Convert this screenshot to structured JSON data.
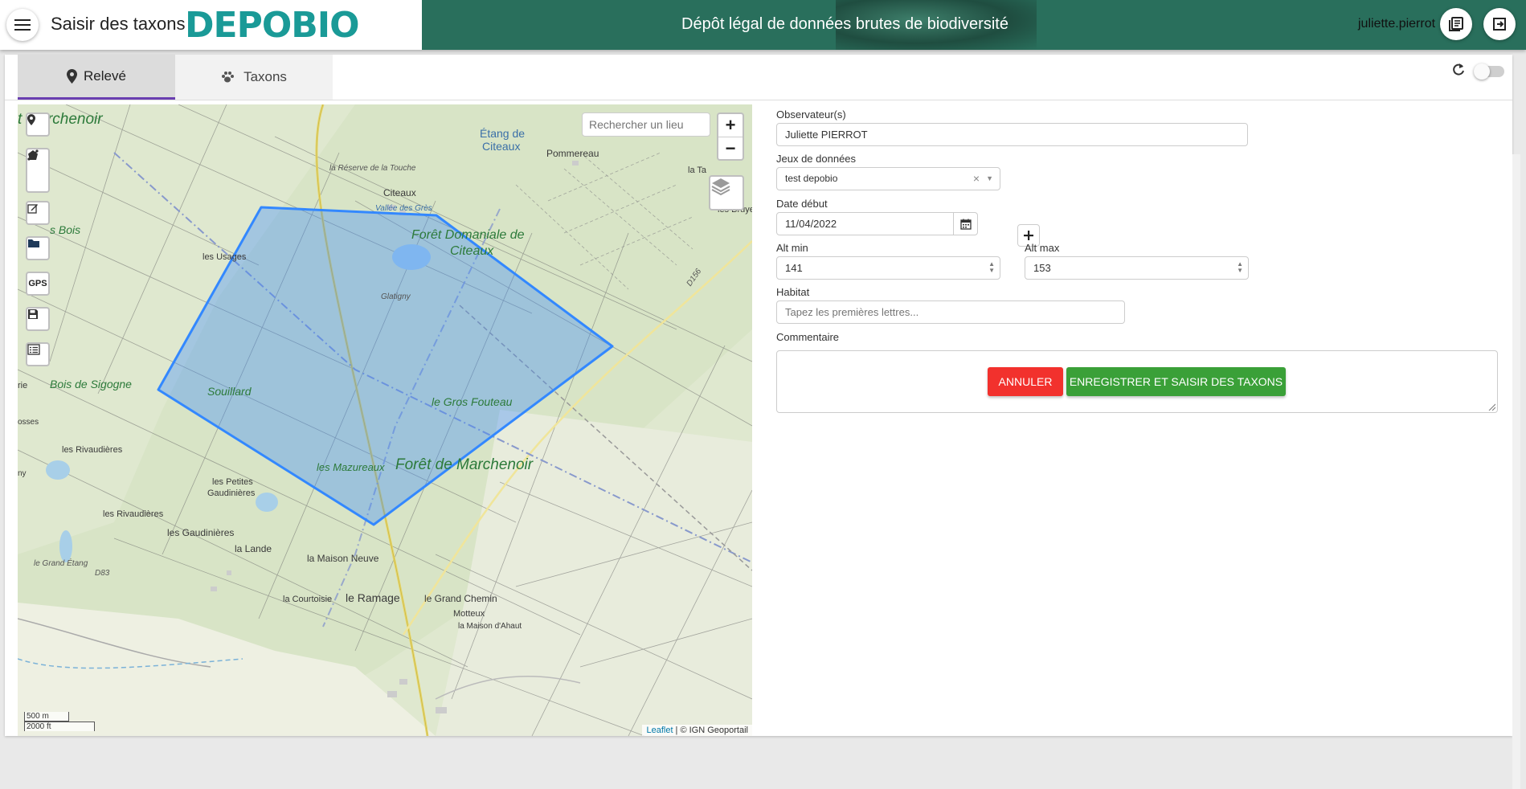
{
  "header": {
    "app_title": "Saisir des taxons",
    "logo_text": "DEPOBIO",
    "banner_text": "Dépôt légal de données brutes de biodiversité",
    "username": "juliette.pierrot",
    "icons": [
      "menu-icon",
      "book-icon",
      "logout-icon"
    ]
  },
  "tabs": [
    {
      "label": "Relevé",
      "icon": "map-marker-icon",
      "active": true
    },
    {
      "label": "Taxons",
      "icon": "paw-icon",
      "active": false
    }
  ],
  "map": {
    "search_placeholder": "Rechercher un lieu",
    "zoom_in": "+",
    "zoom_out": "−",
    "gps_label": "GPS",
    "scale_metric": "500 m",
    "scale_imperial": "2000 ft",
    "attribution_link": "Leaflet",
    "attribution_text": " | © IGN Geoportail",
    "labels": {
      "marchenoir_top": "t Marchenoir",
      "etang_de_citeaux": "Étang de",
      "etang_de_citeaux_2": "Citeaux",
      "pommereau": "Pommereau",
      "reserve": "la Réserve de la Touche",
      "citeaux": "Citeaux",
      "vallee": "Vallée des Grès",
      "foret_domaniale": "Forêt Domaniale de",
      "foret_domaniale_2": "Citeaux",
      "la_ta": "la Ta",
      "les_bruye": "les Bruye",
      "les_bois": "s Bois",
      "les_usages": "les Usages",
      "glatigny": "Glatigny",
      "d156": "D156",
      "bois_de_sigogne": "Bois de Sigogne",
      "souillard": "Souillard",
      "le_gros_fouteau": "le Gros Fouteau",
      "les_rivaudieres": "les Rivaudières",
      "les_mazureaux": "les Mazureaux",
      "foret_de_marchenoir": "Forêt de Marchenoir",
      "les_petites": "les Petites",
      "gaudinieres": "Gaudinières",
      "les_rivaudieres_2": "les Rivaudières",
      "les_gaudinieres": "les Gaudinières",
      "la_lande": "la Lande",
      "le_grand_etang": "le Grand Étang",
      "d83": "D83",
      "la_maison_neuve": "la Maison Neuve",
      "la_courtoisie": "la Courtoisie",
      "le_ramage": "le Ramage",
      "le_grand_chemin": "le Grand Chemin",
      "motteux": "Motteux",
      "la_maison_dahaut": "la Maison d'Ahaut",
      "rie": "rie",
      "osses": "osses",
      "ny": "ny"
    }
  },
  "form": {
    "observateurs_label": "Observateur(s)",
    "observateurs_value": "Juliette PIERROT",
    "jeux_label": "Jeux de données",
    "jeux_value": "test depobio",
    "date_label": "Date début",
    "date_value": "11/04/2022",
    "alt_min_label": "Alt min",
    "alt_min_value": "141",
    "alt_max_label": "Alt max",
    "alt_max_value": "153",
    "habitat_label": "Habitat",
    "habitat_placeholder": "Tapez les premières lettres...",
    "commentaire_label": "Commentaire",
    "annuler": "ANNULER",
    "enregistrer": "ENREGISTRER ET SAISIR DES TAXONS"
  },
  "colors": {
    "logo": "#1a9a97",
    "banner": "#296f5c",
    "tab_active_border": "#6a3fb0",
    "polygon": "#3388ff",
    "cancel": "#f2312d",
    "save": "#3aa038"
  }
}
